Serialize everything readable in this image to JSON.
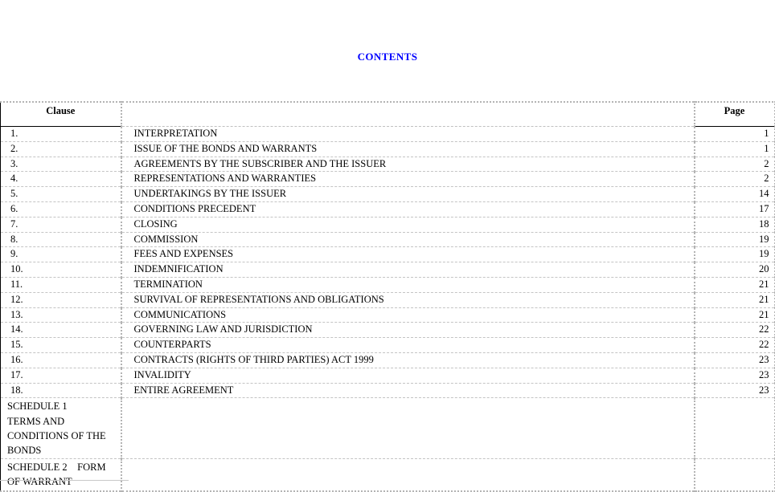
{
  "document": {
    "title": "CONTENTS"
  },
  "table": {
    "headers": {
      "clause": "Clause",
      "title": "",
      "page": "Page"
    },
    "rows": [
      {
        "clause": "1.",
        "title": "INTERPRETATION",
        "page": "1"
      },
      {
        "clause": "2.",
        "title": "ISSUE OF THE BONDS AND WARRANTS",
        "page": "1"
      },
      {
        "clause": "3.",
        "title": "AGREEMENTS BY THE SUBSCRIBER AND THE ISSUER",
        "page": "2"
      },
      {
        "clause": "4.",
        "title": "REPRESENTATIONS AND WARRANTIES",
        "page": "2"
      },
      {
        "clause": "5.",
        "title": "UNDERTAKINGS BY THE ISSUER",
        "page": "14"
      },
      {
        "clause": "6.",
        "title": "CONDITIONS PRECEDENT",
        "page": "17"
      },
      {
        "clause": "7.",
        "title": "CLOSING",
        "page": "18"
      },
      {
        "clause": "8.",
        "title": "COMMISSION",
        "page": "19"
      },
      {
        "clause": "9.",
        "title": "FEES AND EXPENSES",
        "page": "19"
      },
      {
        "clause": "10.",
        "title": "INDEMNIFICATION",
        "page": "20"
      },
      {
        "clause": "11.",
        "title": "TERMINATION",
        "page": "21"
      },
      {
        "clause": "12.",
        "title": "SURVIVAL OF REPRESENTATIONS AND OBLIGATIONS",
        "page": "21"
      },
      {
        "clause": "13.",
        "title": "COMMUNICATIONS",
        "page": "21"
      },
      {
        "clause": "14.",
        "title": "GOVERNING LAW AND JURISDICTION",
        "page": "22"
      },
      {
        "clause": "15.",
        "title": "COUNTERPARTS",
        "page": "22"
      },
      {
        "clause": "16.",
        "title": "CONTRACTS (RIGHTS OF THIRD PARTIES) ACT 1999",
        "page": "23"
      },
      {
        "clause": "17.",
        "title": "INVALIDITY",
        "page": "23"
      },
      {
        "clause": "18.",
        "title": "ENTIRE AGREEMENT",
        "page": "23"
      }
    ],
    "schedules": [
      {
        "lines": [
          "SCHEDULE 1",
          "TERMS AND",
          "CONDITIONS OF THE",
          "BONDS"
        ],
        "title": "",
        "page": ""
      },
      {
        "lines": [
          "SCHEDULE 2 FORM",
          "OF WARRANT"
        ],
        "title": "",
        "page": ""
      }
    ]
  },
  "colors": {
    "title_blue": "#0000FF",
    "text_black": "#000000",
    "rule_gray": "#C4C4C4"
  }
}
